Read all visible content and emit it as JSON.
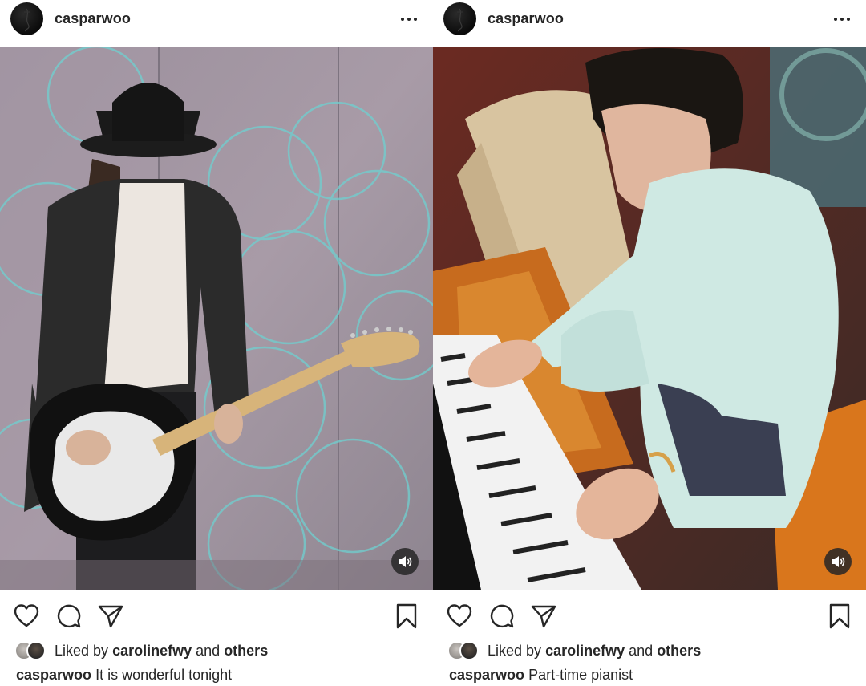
{
  "posts": [
    {
      "username": "casparwoo",
      "liked_prefix": "Liked by",
      "liked_user": "carolinefwy",
      "liked_and": "and",
      "liked_others": "others",
      "caption_user": "casparwoo",
      "caption_text": "It is wonderful tonight",
      "media_subject": "guitar-player-photo"
    },
    {
      "username": "casparwoo",
      "liked_prefix": "Liked by",
      "liked_user": "carolinefwy",
      "liked_and": "and",
      "liked_others": "others",
      "caption_user": "casparwoo",
      "caption_text": "Part-time pianist",
      "media_subject": "piano-player-photo"
    }
  ],
  "icons": {
    "more": "more-options-icon",
    "like": "heart-icon",
    "comment": "comment-icon",
    "share": "send-icon",
    "save": "bookmark-icon",
    "sound": "speaker-icon"
  },
  "colors": {
    "text": "#262626",
    "background": "#ffffff",
    "sound_button": "#262626"
  }
}
